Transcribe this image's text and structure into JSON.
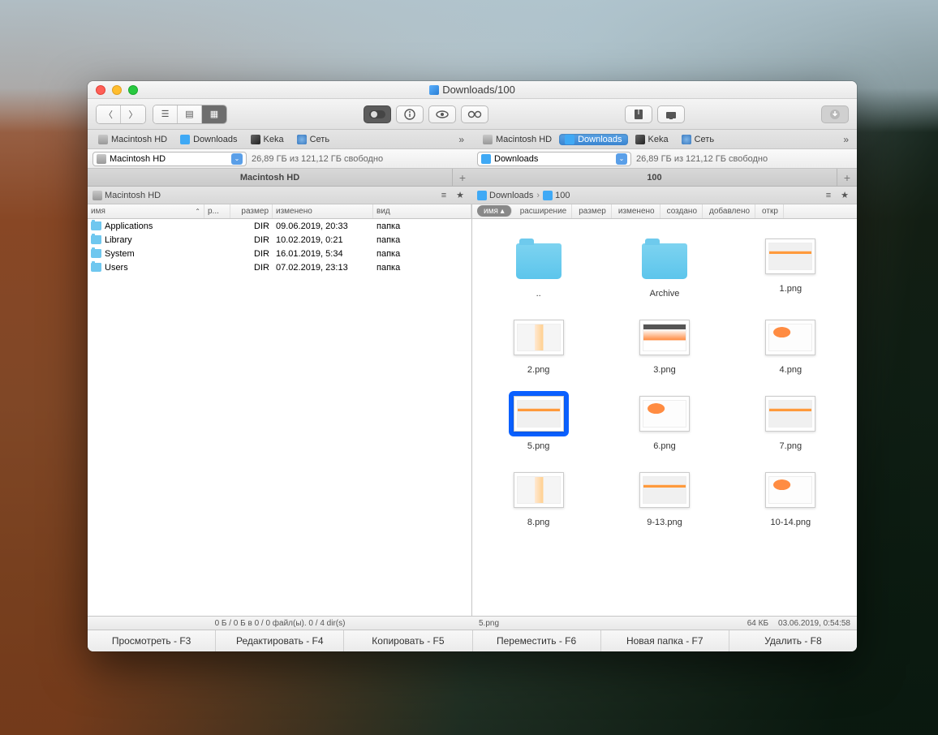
{
  "window": {
    "title": "Downloads/100"
  },
  "toolbar": {
    "disk_info": "26,89 ГБ из 121,12 ГБ свободно"
  },
  "favorites": [
    {
      "label": "Macintosh HD",
      "icon": "hd",
      "active": false
    },
    {
      "label": "Downloads",
      "icon": "dl",
      "active_left": false,
      "active_right": true
    },
    {
      "label": "Keka",
      "icon": "keka"
    },
    {
      "label": "Сеть",
      "icon": "net"
    }
  ],
  "left": {
    "drive_label": "Macintosh HD",
    "tab": "Macintosh HD",
    "breadcrumb": [
      {
        "label": "Macintosh HD",
        "icon": "hd"
      }
    ],
    "columns": {
      "name": "имя",
      "r": "р...",
      "size": "размер",
      "mod": "изменено",
      "type": "вид"
    },
    "rows": [
      {
        "name": "Applications",
        "size": "DIR",
        "mod": "09.06.2019, 20:33",
        "type": "папка"
      },
      {
        "name": "Library",
        "size": "DIR",
        "mod": "10.02.2019, 0:21",
        "type": "папка"
      },
      {
        "name": "System",
        "size": "DIR",
        "mod": "16.01.2019, 5:34",
        "type": "папка"
      },
      {
        "name": "Users",
        "size": "DIR",
        "mod": "07.02.2019, 23:13",
        "type": "папка"
      }
    ],
    "status": "0 Б / 0 Б в 0 / 0 файл(ы). 0 / 4 dir(s)"
  },
  "right": {
    "drive_label": "Downloads",
    "tab": "100",
    "breadcrumb": [
      {
        "label": "Downloads",
        "icon": "dl"
      },
      {
        "label": "100",
        "icon": "dl"
      }
    ],
    "columns": [
      "имя",
      "расширение",
      "размер",
      "изменено",
      "создано",
      "добавлено",
      "откр"
    ],
    "active_col": "имя",
    "items": [
      {
        "label": "..",
        "kind": "folder"
      },
      {
        "label": "Archive",
        "kind": "folder"
      },
      {
        "label": "1.png",
        "kind": "img",
        "variant": "v2"
      },
      {
        "label": "2.png",
        "kind": "img",
        "variant": ""
      },
      {
        "label": "3.png",
        "kind": "img",
        "variant": "v3"
      },
      {
        "label": "4.png",
        "kind": "img",
        "variant": "v4"
      },
      {
        "label": "5.png",
        "kind": "img",
        "variant": "v2",
        "selected": true
      },
      {
        "label": "6.png",
        "kind": "img",
        "variant": "v4"
      },
      {
        "label": "7.png",
        "kind": "img",
        "variant": "v2"
      },
      {
        "label": "8.png",
        "kind": "img",
        "variant": ""
      },
      {
        "label": "9-13.png",
        "kind": "img",
        "variant": "v2"
      },
      {
        "label": "10-14.png",
        "kind": "img",
        "variant": "v4"
      }
    ],
    "status_name": "5.png",
    "status_size": "64 КБ",
    "status_date": "03.06.2019, 0:54:58"
  },
  "fkeys": [
    "Просмотреть - F3",
    "Редактировать - F4",
    "Копировать - F5",
    "Переместить - F6",
    "Новая папка - F7",
    "Удалить - F8"
  ]
}
